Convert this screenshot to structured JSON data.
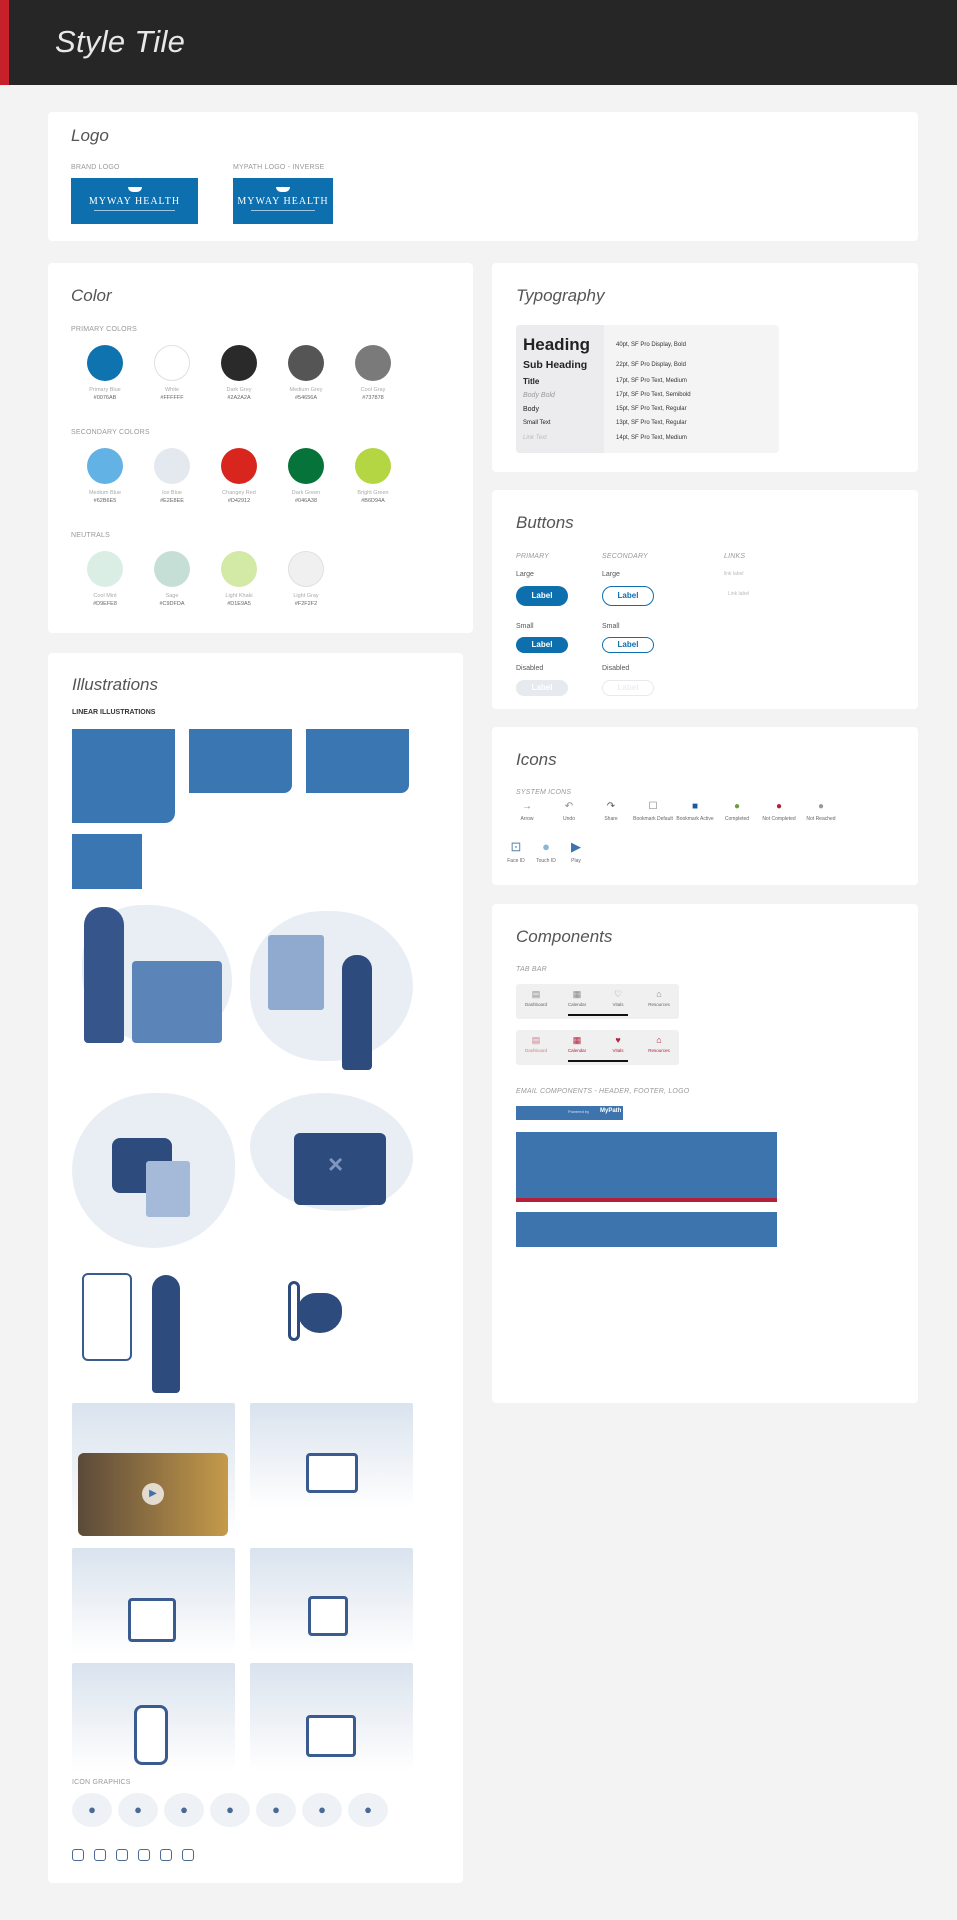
{
  "header": {
    "title": "Style Tile"
  },
  "logo": {
    "title": "Logo",
    "brand_caption": "BRAND LOGO",
    "inverse_caption": "MYPATH LOGO - INVERSE",
    "brand_text": "MYWAY HEALTH",
    "inverse_text": "MYWAY HEALTH"
  },
  "color": {
    "title": "Color",
    "primary_caption": "PRIMARY COLORS",
    "secondary_caption": "SECONDARY COLORS",
    "neutrals_caption": "NEUTRALS",
    "primary": [
      {
        "name": "Primary Blue",
        "hex": "#0076AB",
        "color": "#0e73ae"
      },
      {
        "name": "White",
        "hex": "#FFFFFF",
        "color": "#ffffff"
      },
      {
        "name": "Dark Grey",
        "hex": "#2A2A2A",
        "color": "#2a2a2a"
      },
      {
        "name": "Medium Grey",
        "hex": "#54656A",
        "color": "#555555"
      },
      {
        "name": "Cool Gray",
        "hex": "#737878",
        "color": "#7a7a7a"
      }
    ],
    "secondary": [
      {
        "name": "Medium Blue",
        "hex": "#62B6E5",
        "color": "#62b2e6"
      },
      {
        "name": "Ice Blue",
        "hex": "#E2E8EE",
        "color": "#e4e8ef"
      },
      {
        "name": "Changey Red",
        "hex": "#D42912",
        "color": "#d8261f"
      },
      {
        "name": "Dark Green",
        "hex": "#046A38",
        "color": "#06733a"
      },
      {
        "name": "Bright Green",
        "hex": "#B6D94A",
        "color": "#b4d643"
      }
    ],
    "neutrals": [
      {
        "name": "Cool Mint",
        "hex": "#D9EFE8",
        "color": "#dbeee6"
      },
      {
        "name": "Sage",
        "hex": "#C9DFDA",
        "color": "#c6dfd6"
      },
      {
        "name": "Light Khaki",
        "hex": "#D1E9A5",
        "color": "#d3e9a6"
      },
      {
        "name": "Light Gray",
        "hex": "#F2F2F2",
        "color": "#f0f0f0"
      }
    ]
  },
  "typography": {
    "title": "Typography",
    "rows": [
      {
        "sample": "Heading",
        "spec": "40pt, SF Pro Display, Bold"
      },
      {
        "sample": "Sub Heading",
        "spec": "22pt, SF Pro Display, Bold"
      },
      {
        "sample": "Title",
        "spec": "17pt, SF Pro Text, Medium"
      },
      {
        "sample": "Body Bold",
        "spec": "17pt, SF Pro Text, Semibold"
      },
      {
        "sample": "Body",
        "spec": "15pt, SF Pro Text, Regular"
      },
      {
        "sample": "Small Text",
        "spec": "13pt, SF Pro Text, Regular"
      },
      {
        "sample": "Link Text",
        "spec": "14pt, SF Pro Text, Medium"
      }
    ]
  },
  "buttons": {
    "title": "Buttons",
    "primary_caption": "PRIMARY",
    "secondary_caption": "SECONDARY",
    "links_caption": "LINKS",
    "large": "Large",
    "small": "Small",
    "disabled": "Disabled",
    "label": "Label",
    "link_1": "link label",
    "link_2": "Link label"
  },
  "icons": {
    "title": "Icons",
    "caption": "SYSTEM ICONS",
    "row1": [
      {
        "name": "Arrow",
        "glyph": "→"
      },
      {
        "name": "Undo",
        "glyph": "↶"
      },
      {
        "name": "Share",
        "glyph": "↷"
      },
      {
        "name": "Bookmark Default",
        "glyph": "☐"
      },
      {
        "name": "Bookmark Active",
        "glyph": "■"
      },
      {
        "name": "Completed",
        "glyph": "●"
      },
      {
        "name": "Not Completed",
        "glyph": "●"
      },
      {
        "name": "Not Reached",
        "glyph": "●"
      }
    ],
    "row2": [
      {
        "name": "Face ID",
        "glyph": "⊡"
      },
      {
        "name": "Touch ID",
        "glyph": "●"
      },
      {
        "name": "Play",
        "glyph": "▶"
      }
    ]
  },
  "components": {
    "title": "Components",
    "tabbar_caption": "TAB BAR",
    "email_caption": "EMAIL COMPONENTS - HEADER, FOOTER, LOGO",
    "tabs": [
      "Dashboard",
      "Calendar",
      "Vitals",
      "Resources"
    ],
    "email_small_a": "Powered by",
    "email_small_b": "MyPath"
  },
  "illustrations": {
    "title": "Illustrations",
    "linear_caption": "LINEAR ILLUSTRATIONS",
    "icon_graphics_caption": "ICON GRAPHICS"
  }
}
